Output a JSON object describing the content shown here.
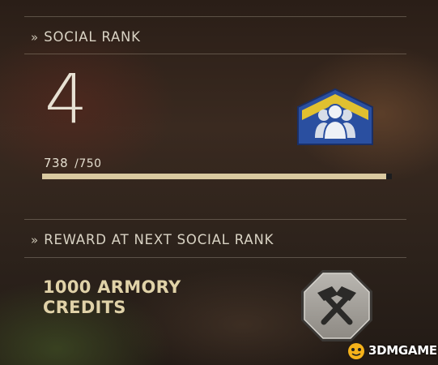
{
  "social_rank": {
    "section_title": "SOCIAL RANK",
    "chevron": "»",
    "rank": "4",
    "progress_current": "738",
    "progress_max": "/750",
    "progress_fraction": 0.984,
    "badge_icon": "social-rank-badge-icon"
  },
  "reward": {
    "section_title": "REWARD AT NEXT SOCIAL RANK",
    "chevron": "»",
    "line1": "1000 ARMORY",
    "line2": "CREDITS",
    "icon": "hammers-icon"
  },
  "watermark": {
    "text": "3DMGAME"
  },
  "colors": {
    "text_primary": "#e7e1d3",
    "accent_gold": "#d9c9a0",
    "reward_text": "#e0d2a8",
    "badge_blue": "#2a4fa0",
    "badge_yellow": "#e0c030"
  }
}
